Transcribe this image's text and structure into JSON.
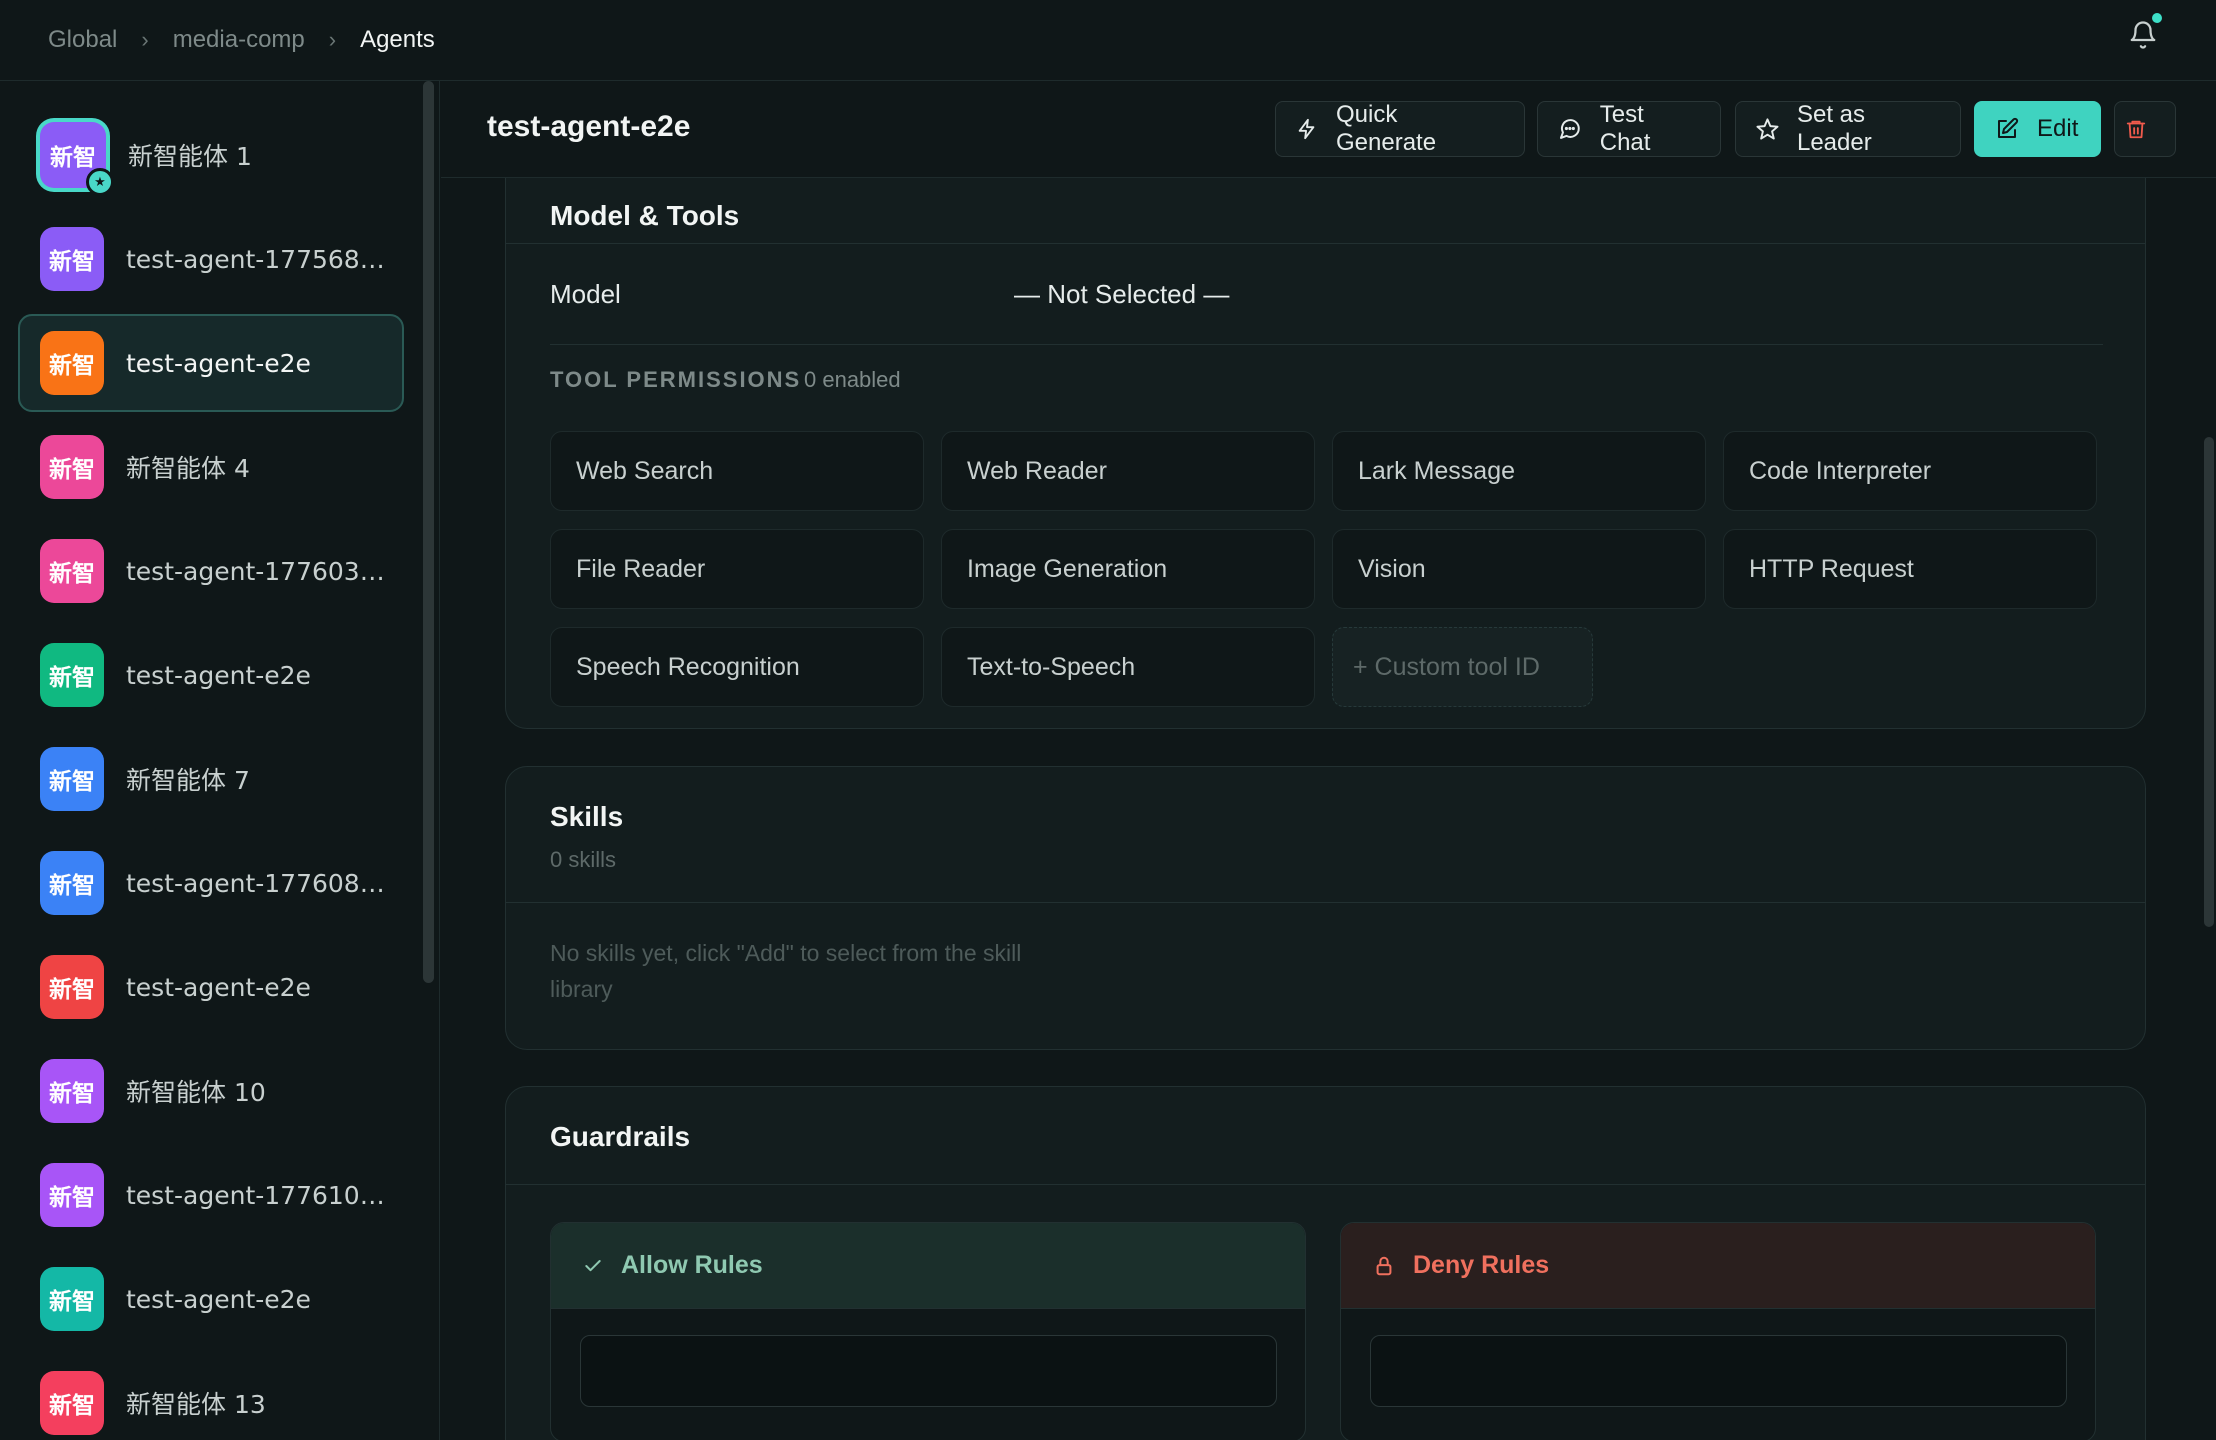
{
  "breadcrumb": {
    "items": [
      "Global",
      "media-comp",
      "Agents"
    ]
  },
  "colors": {
    "accent": "#3fd3c0",
    "allow": "#8fc9b1",
    "deny": "#f0705e"
  },
  "agents": [
    {
      "name": "新智能体 1",
      "avatar": "新智",
      "color": "#8b5cf6",
      "leader": true
    },
    {
      "name": "test-agent-177568420...",
      "avatar": "新智",
      "color": "#8b5cf6"
    },
    {
      "name": "test-agent-e2e",
      "avatar": "新智",
      "color": "#f97316",
      "active": true
    },
    {
      "name": "新智能体 4",
      "avatar": "新智",
      "color": "#ec4899"
    },
    {
      "name": "test-agent-177603910...",
      "avatar": "新智",
      "color": "#ec4899"
    },
    {
      "name": "test-agent-e2e",
      "avatar": "新智",
      "color": "#10b981"
    },
    {
      "name": "新智能体 7",
      "avatar": "新智",
      "color": "#3b82f6"
    },
    {
      "name": "test-agent-177608503...",
      "avatar": "新智",
      "color": "#3b82f6"
    },
    {
      "name": "test-agent-e2e",
      "avatar": "新智",
      "color": "#ef4444"
    },
    {
      "name": "新智能体 10",
      "avatar": "新智",
      "color": "#a855f7"
    },
    {
      "name": "test-agent-1776102410...",
      "avatar": "新智",
      "color": "#a855f7"
    },
    {
      "name": "test-agent-e2e",
      "avatar": "新智",
      "color": "#14b8a6"
    },
    {
      "name": "新智能体 13",
      "avatar": "新智",
      "color": "#f43f5e"
    }
  ],
  "header": {
    "title": "test-agent-e2e",
    "quick_generate": "Quick Generate",
    "test_chat": "Test Chat",
    "set_leader": "Set as Leader",
    "edit": "Edit"
  },
  "model_tools": {
    "title": "Model & Tools",
    "model_label": "Model",
    "model_value": "— Not Selected —",
    "perm_label": "TOOL PERMISSIONS",
    "perm_count": "0 enabled",
    "tools": [
      "Web Search",
      "Web Reader",
      "Lark Message",
      "Code Interpreter",
      "File Reader",
      "Image Generation",
      "Vision",
      "HTTP Request",
      "Speech Recognition",
      "Text-to-Speech"
    ],
    "custom_tool": "+ Custom tool ID"
  },
  "skills": {
    "title": "Skills",
    "count": "0 skills",
    "empty": "No skills yet, click \"Add\" to select from the skill library"
  },
  "guardrails": {
    "title": "Guardrails",
    "allow": "Allow Rules",
    "deny": "Deny Rules"
  }
}
